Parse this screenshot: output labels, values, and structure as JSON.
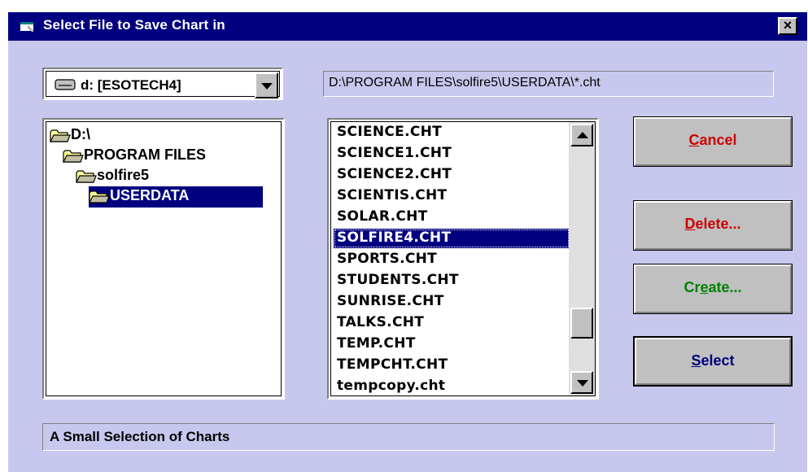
{
  "window": {
    "title": "Select File to Save Chart in",
    "close_glyph": "×",
    "colors": {
      "titlebar": "#000080",
      "background": "#c8c8ee"
    }
  },
  "drive_select": {
    "value": "d: [ESOTECH4]",
    "icon": "drive-icon"
  },
  "path": "D:\\PROGRAM FILES\\solfire5\\USERDATA\\*.cht",
  "directories": [
    {
      "label": "D:\\",
      "level": 0,
      "icon": "folder-open-icon",
      "selected": false
    },
    {
      "label": "PROGRAM FILES",
      "level": 1,
      "icon": "folder-open-icon",
      "selected": false
    },
    {
      "label": "solfire5",
      "level": 2,
      "icon": "folder-open-icon",
      "selected": false
    },
    {
      "label": "USERDATA",
      "level": 3,
      "icon": "folder-open-icon",
      "selected": true
    }
  ],
  "files": [
    {
      "label": "SCIENCE.CHT",
      "selected": false
    },
    {
      "label": "SCIENCE1.CHT",
      "selected": false
    },
    {
      "label": "SCIENCE2.CHT",
      "selected": false
    },
    {
      "label": "SCIENTIS.CHT",
      "selected": false
    },
    {
      "label": "SOLAR.CHT",
      "selected": false
    },
    {
      "label": "SOLFIRE4.CHT",
      "selected": true
    },
    {
      "label": "SPORTS.CHT",
      "selected": false
    },
    {
      "label": "STUDENTS.CHT",
      "selected": false
    },
    {
      "label": "SUNRISE.CHT",
      "selected": false
    },
    {
      "label": "TALKS.CHT",
      "selected": false
    },
    {
      "label": "TEMP.CHT",
      "selected": false
    },
    {
      "label": "TEMPCHT.CHT",
      "selected": false
    },
    {
      "label": "tempcopy.cht",
      "selected": false
    }
  ],
  "buttons": {
    "cancel": {
      "pre": "",
      "mnemonic": "C",
      "post": "ancel",
      "color": "#cc0000"
    },
    "delete": {
      "pre": "",
      "mnemonic": "D",
      "post": "elete...",
      "color": "#cc0000"
    },
    "create": {
      "pre": "Cr",
      "mnemonic": "e",
      "post": "ate...",
      "color": "#008000"
    },
    "select": {
      "pre": "",
      "mnemonic": "S",
      "post": "elect",
      "color": "#000080"
    }
  },
  "status": "A Small Selection of Charts"
}
